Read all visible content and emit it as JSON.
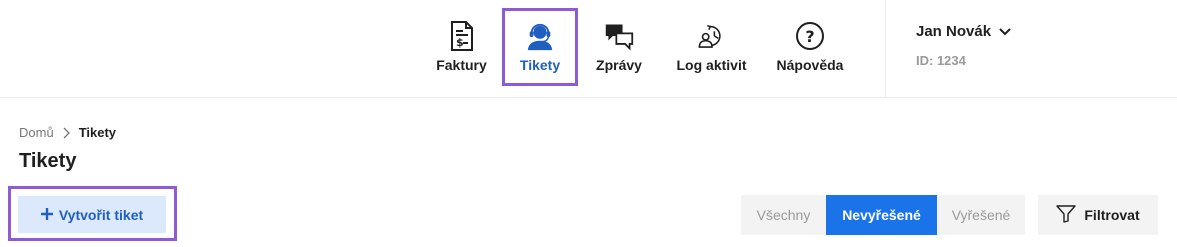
{
  "nav": {
    "items": [
      {
        "label": "Faktury",
        "icon": "invoice-icon",
        "active": false
      },
      {
        "label": "Tikety",
        "icon": "headset-support-icon",
        "active": true
      },
      {
        "label": "Zprávy",
        "icon": "chat-bubbles-icon",
        "active": false
      },
      {
        "label": "Log aktivit",
        "icon": "activity-log-icon",
        "active": false
      },
      {
        "label": "Nápověda",
        "icon": "help-icon",
        "active": false
      }
    ]
  },
  "user": {
    "name": "Jan Novák",
    "id": "ID: 1234"
  },
  "breadcrumb": {
    "home": "Domů",
    "current": "Tikety"
  },
  "page": {
    "title": "Tikety"
  },
  "actions": {
    "create_label": "Vytvořit tiket",
    "filter_label": "Filtrovat"
  },
  "status_filter": {
    "options": [
      "Všechny",
      "Nevyřešené",
      "Vyřešené"
    ],
    "selected": "Nevyřešené"
  },
  "colors": {
    "accent": "#1a73e8",
    "highlight_outline": "#8e5bd6",
    "create_button_bg": "#dce8fb"
  }
}
